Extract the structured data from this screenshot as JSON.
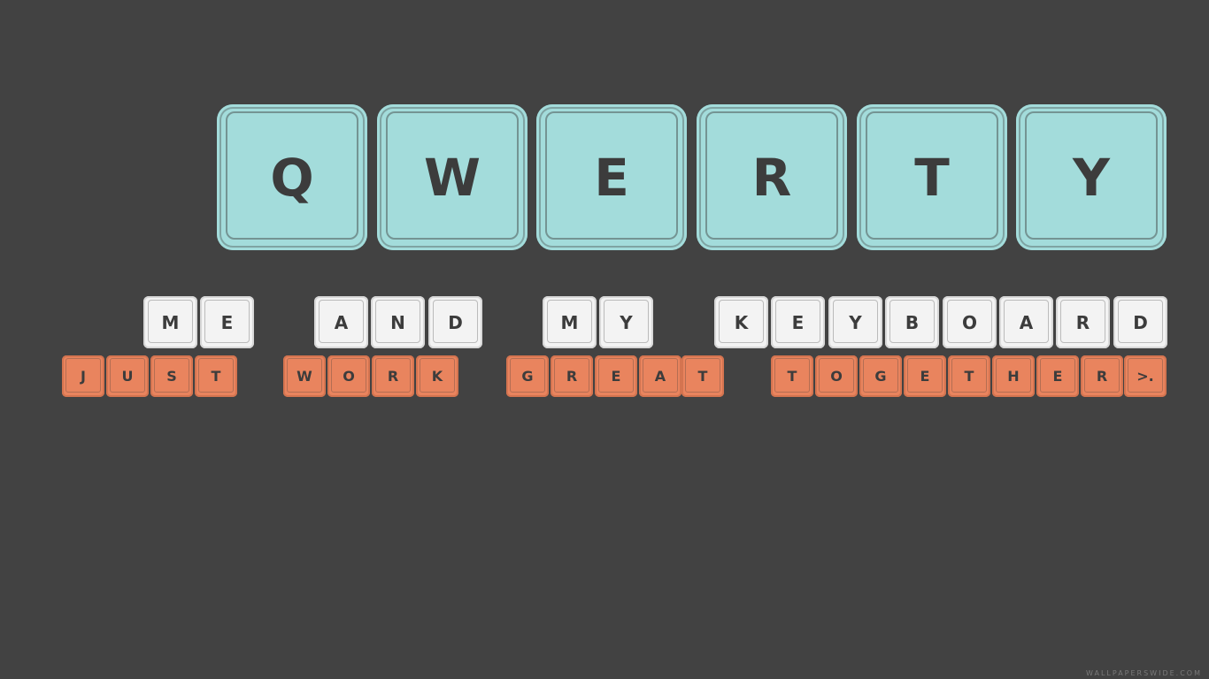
{
  "big_keys": [
    "Q",
    "W",
    "E",
    "R",
    "T",
    "Y"
  ],
  "line1": {
    "word1": [
      "M",
      "E"
    ],
    "word2": [
      "A",
      "N",
      "D"
    ],
    "word3": [
      "M",
      "Y"
    ],
    "word4": [
      "K",
      "E",
      "Y",
      "B",
      "O",
      "A",
      "R",
      "D"
    ]
  },
  "line2": {
    "word1": [
      "J",
      "U",
      "S",
      "T"
    ],
    "word2": [
      "W",
      "O",
      "R",
      "K"
    ],
    "word3": [
      "G",
      "R",
      "E",
      "A",
      "T"
    ],
    "word4": [
      "T",
      "O",
      "G",
      "E",
      "T",
      "H",
      "E",
      "R",
      ">."
    ]
  },
  "watermark": "WALLPAPERSWIDE.COM",
  "colors": {
    "background": "#424242",
    "teal_key": "#a3dcdb",
    "white_key": "#f3f3f3",
    "orange_key": "#e9845e",
    "key_text": "#3c3c3c"
  }
}
